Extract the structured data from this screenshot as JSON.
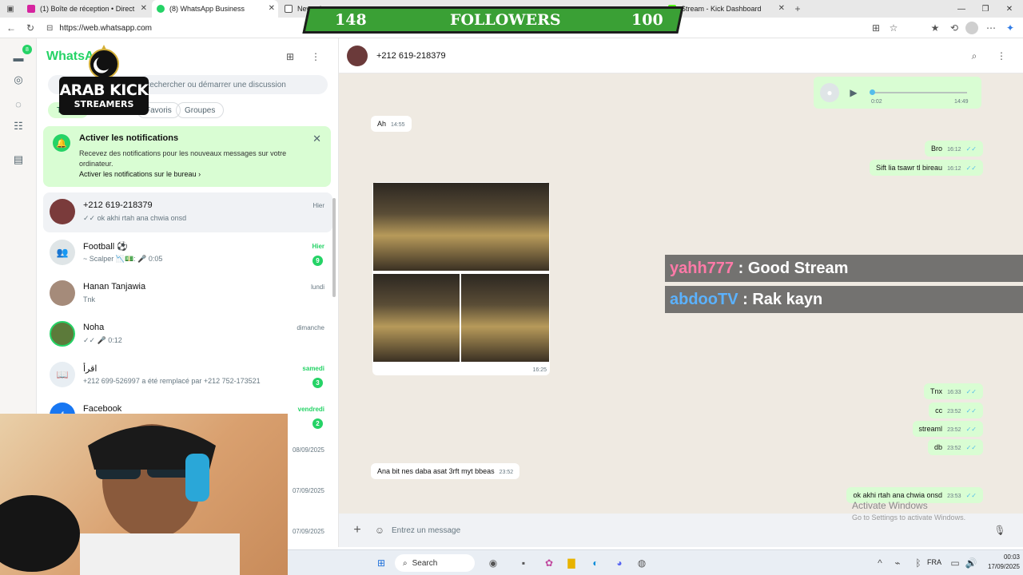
{
  "browser": {
    "tabs": [
      {
        "label": "(1) Boîte de réception • Direct"
      },
      {
        "label": "(8) WhatsApp Business"
      },
      {
        "label": "New tab"
      },
      {
        "label": "Stream - Kick Dashboard"
      }
    ],
    "url": "https://web.whatsapp.com"
  },
  "sidebar": {
    "brand": "WhatsApp",
    "search_placeholder": "Rechercher ou démarrer une discussion",
    "filters": [
      "Toutes",
      "Favoris",
      "Groupes"
    ],
    "rail_badge": "8",
    "notification": {
      "title": "Activer les notifications",
      "desc": "Recevez des notifications pour les nouveaux messages sur votre ordinateur.",
      "link": "Activer les notifications sur le bureau ›"
    },
    "chats": [
      {
        "name": "+212 619-218379",
        "preview": "✓✓ ok akhi rtah ana chwia onsd",
        "time": "Hier"
      },
      {
        "name": "Football ⚽",
        "preview": "~ Scalper 📉💵: 🎤 0:05",
        "time": "Hier",
        "badge": "9"
      },
      {
        "name": "Hanan Tanjawia",
        "preview": "Tnk",
        "time": "lundi"
      },
      {
        "name": "Noha",
        "preview": "✓✓ 🎤 0:12",
        "time": "dimanche"
      },
      {
        "name": "اقرأ",
        "preview": "+212 699-526997 a été remplacé par +212 752-173521",
        "time": "samedi",
        "badge": "3"
      },
      {
        "name": "Facebook",
        "preview": "",
        "time": "vendredi",
        "badge": "2"
      }
    ],
    "partial_times": [
      "08/09/2025",
      "07/09/2025",
      "07/09/2025"
    ]
  },
  "conversation": {
    "contact": "+212 619-218379",
    "voice": {
      "duration": "0:02",
      "time": "14:49"
    },
    "messages": [
      {
        "text": "Ah",
        "time": "14:55"
      },
      {
        "text": "Bro",
        "time": "16:12"
      },
      {
        "text": "Sift lia tsawr tl bireau",
        "time": "16:12"
      },
      {
        "text": "",
        "time": "16:25"
      },
      {
        "text": "Tnx",
        "time": "16:33"
      },
      {
        "text": "cc",
        "time": "23:52"
      },
      {
        "text": "streaml",
        "time": "23:52"
      },
      {
        "text": "db",
        "time": "23:52"
      },
      {
        "text": "Ana bit nes daba asat 3rft myt bbeas",
        "time": "23:52"
      },
      {
        "text": "ok akhi rtah ana chwia onsd",
        "time": "23:53"
      }
    ],
    "composer_placeholder": "Entrez un message"
  },
  "overlay": {
    "followers_left": "148",
    "followers_label": "FOLLOWERS",
    "followers_right": "100",
    "logo_line1": "ARAB KICK",
    "logo_line2": "STREAMERS",
    "chat": [
      {
        "user": "yahh777",
        "text": ": Good Stream"
      },
      {
        "user": "abdooTV",
        "text": ": Rak kayn"
      }
    ]
  },
  "windows": {
    "activate_title": "Activate Windows",
    "activate_sub": "Go to Settings to activate Windows.",
    "search": "Search",
    "lang": "FRA",
    "time": "00:03",
    "date": "17/09/2025"
  },
  "colors": {
    "accent": "#25d366",
    "bubble_out": "#d9fdd3",
    "chat_bg": "#efeae2"
  }
}
